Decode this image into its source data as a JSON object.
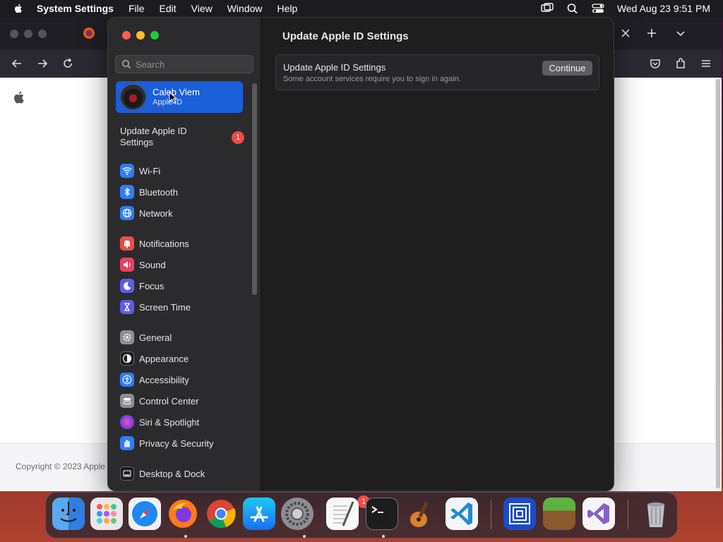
{
  "menubar": {
    "app_name": "System Settings",
    "menus": [
      "File",
      "Edit",
      "View",
      "Window",
      "Help"
    ],
    "clock": "Wed Aug 23  9:51 PM"
  },
  "browser": {
    "footer_text": "Copyright © 2023 Apple"
  },
  "sidebar": {
    "search_placeholder": "Search",
    "profile": {
      "name": "Caleb Viem",
      "subtitle": "Apple ID"
    },
    "update": {
      "label": "Update Apple ID Settings",
      "badge": "1"
    },
    "items": [
      {
        "label": "Wi-Fi",
        "icon": "wifi-icon",
        "color": "#2f7cf6"
      },
      {
        "label": "Bluetooth",
        "icon": "bluetooth-icon",
        "color": "#2f7cf6"
      },
      {
        "label": "Network",
        "icon": "globe-icon",
        "color": "#2f7cf6"
      },
      {
        "label": "Notifications",
        "icon": "bell-icon",
        "color": "#ec4d45"
      },
      {
        "label": "Sound",
        "icon": "speaker-icon",
        "color": "#ec3f63"
      },
      {
        "label": "Focus",
        "icon": "moon-icon",
        "color": "#5e5ce6"
      },
      {
        "label": "Screen Time",
        "icon": "hourglass-icon",
        "color": "#5e5ce6"
      },
      {
        "label": "General",
        "icon": "gear-icon",
        "color": "#8e8e93"
      },
      {
        "label": "Appearance",
        "icon": "appearance-icon",
        "color": "#1c1c1e"
      },
      {
        "label": "Accessibility",
        "icon": "accessibility-icon",
        "color": "#2f7cf6"
      },
      {
        "label": "Control Center",
        "icon": "control-center-icon",
        "color": "#8e8e93"
      },
      {
        "label": "Siri & Spotlight",
        "icon": "siri-icon",
        "color": "#a040c0"
      },
      {
        "label": "Privacy & Security",
        "icon": "hand-icon",
        "color": "#2f7cf6"
      },
      {
        "label": "Desktop & Dock",
        "icon": "dock-icon",
        "color": "#1c1c1e"
      }
    ]
  },
  "main": {
    "title": "Update Apple ID Settings",
    "card": {
      "title": "Update Apple ID Settings",
      "subtitle": "Some account services require you to sign in again.",
      "button": "Continue"
    }
  },
  "dock": {
    "apps": [
      "Finder",
      "Launchpad",
      "Safari",
      "Firefox",
      "Chrome",
      "App Store",
      "System Settings",
      "TextEdit",
      "Terminal",
      "GarageBand",
      "Visual Studio Code",
      "Screens",
      "Minecraft",
      "Visual Studio",
      "Trash"
    ],
    "settings_badge": "1"
  }
}
